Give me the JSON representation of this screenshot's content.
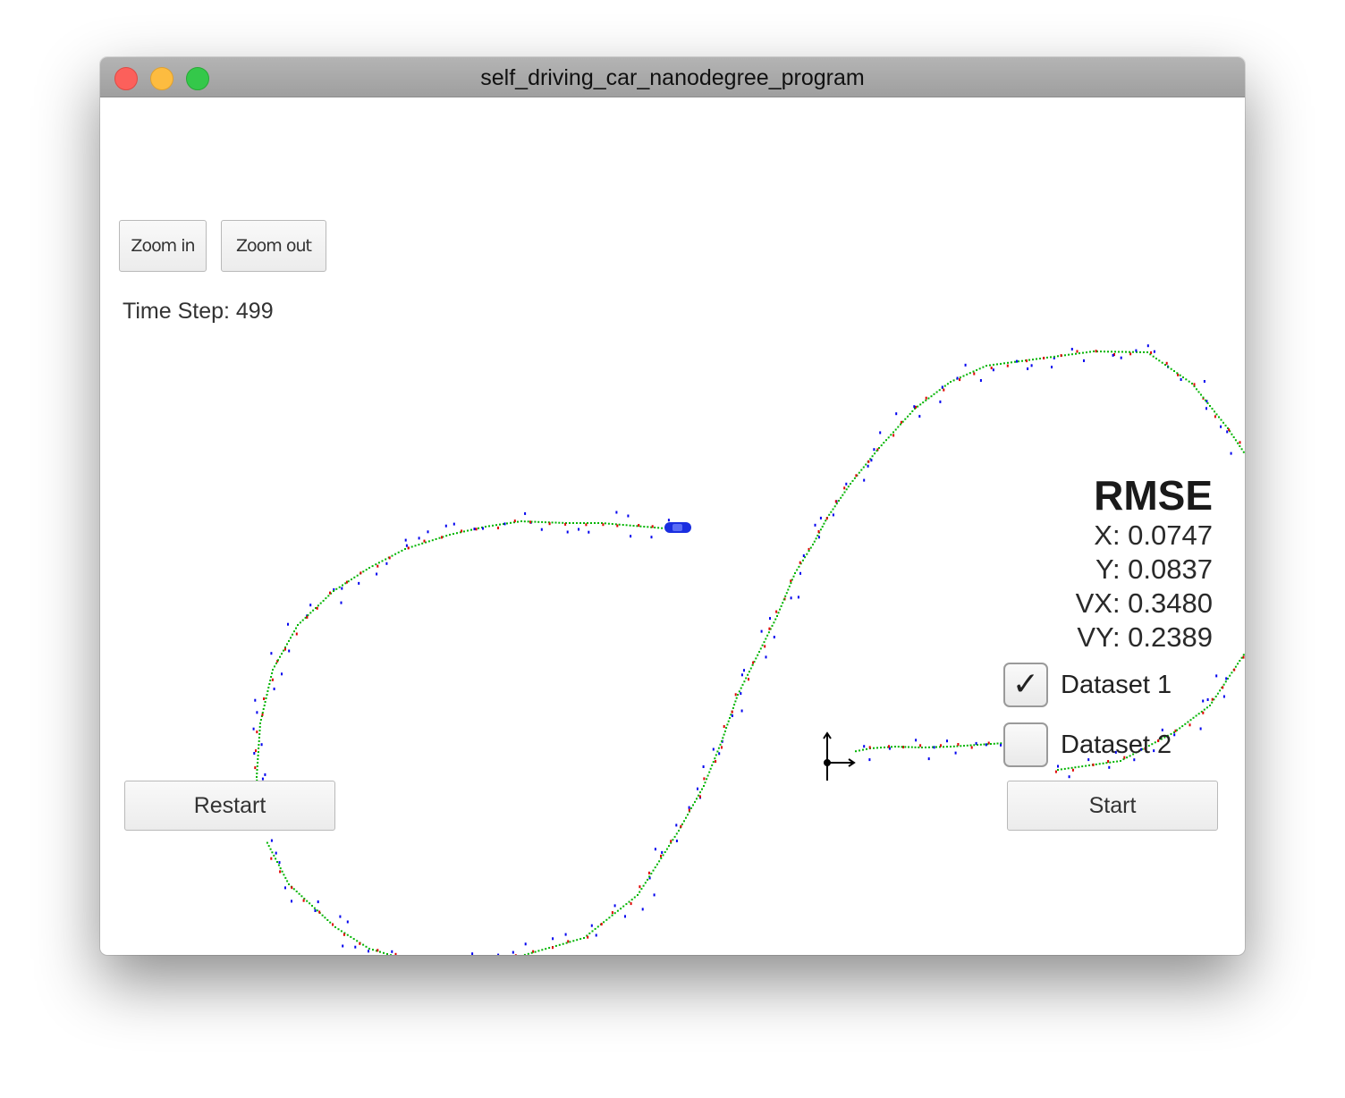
{
  "window": {
    "title": "self_driving_car_nanodegree_program"
  },
  "toolbar": {
    "zoom_in_label": "Zoom in",
    "zoom_out_label": "Zoom out"
  },
  "status": {
    "time_step": "Time Step: 499"
  },
  "rmse": {
    "title": "RMSE",
    "x": "X: 0.0747",
    "y": "Y: 0.0837",
    "vx": "VX: 0.3480",
    "vy": "VY: 0.2389"
  },
  "datasets": [
    {
      "label": "Dataset 1",
      "checked": true
    },
    {
      "label": "Dataset 2",
      "checked": false
    }
  ],
  "controls": {
    "restart_label": "Restart",
    "start_label": "Start"
  },
  "colors": {
    "ground_truth": "#00b400",
    "lidar": "#e00000",
    "radar": "#0000ee",
    "car": "#1a2ee0"
  }
}
